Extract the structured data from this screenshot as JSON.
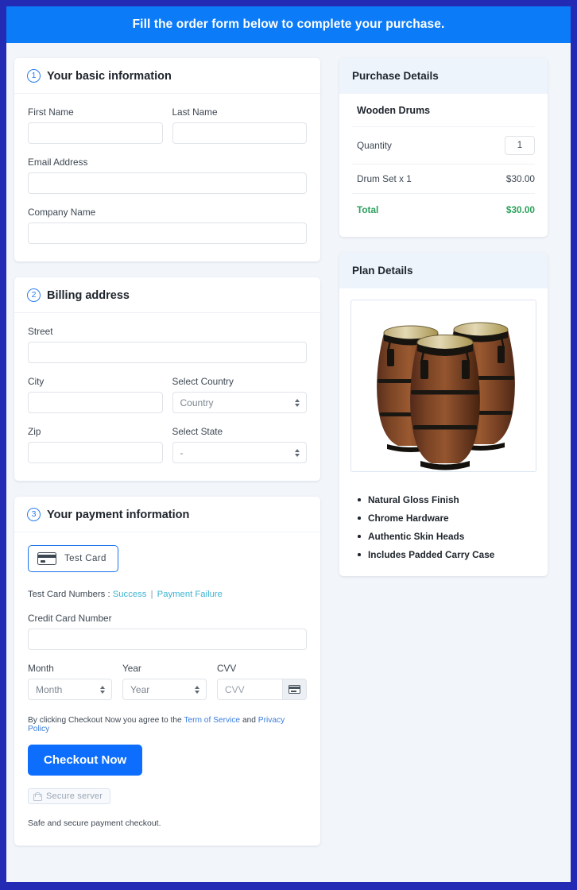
{
  "banner": {
    "text": "Fill the order form below to complete your purchase."
  },
  "colors": {
    "banner_blue": "#0b7bf8",
    "frame_navy": "#232ab4",
    "page_bg": "#f2f5f9",
    "accent_blue": "#0d6efd",
    "total_green": "#2ca05c",
    "link_teal": "#3fb3d2"
  },
  "sections": {
    "basic": {
      "step": "1",
      "title": "Your basic information",
      "fields": {
        "first_name_label": "First Name",
        "first_name_value": "",
        "last_name_label": "Last Name",
        "last_name_value": "",
        "email_label": "Email Address",
        "email_value": "",
        "company_label": "Company Name",
        "company_value": ""
      }
    },
    "billing": {
      "step": "2",
      "title": "Billing address",
      "fields": {
        "street_label": "Street",
        "street_value": "",
        "city_label": "City",
        "city_value": "",
        "country_label": "Select Country",
        "country_value": "Country",
        "zip_label": "Zip",
        "zip_value": "",
        "state_label": "Select State",
        "state_value": "-"
      }
    },
    "payment": {
      "step": "3",
      "title": "Your payment information",
      "card_tab_label": "Test  Card",
      "test_numbers_label": "Test Card Numbers :",
      "test_success_link": "Success",
      "test_separator": "|",
      "test_failure_link": "Payment Failure",
      "card_number_label": "Credit Card Number",
      "card_number_value": "",
      "month_label": "Month",
      "month_value": "Month",
      "year_label": "Year",
      "year_value": "Year",
      "cvv_label": "CVV",
      "cvv_placeholder": "CVV",
      "terms_prefix": "By clicking Checkout Now you agree to the",
      "terms_link": "Term of Service",
      "terms_and": "and",
      "privacy_link": "Privacy Policy",
      "checkout_button": "Checkout Now",
      "secure_badge": "Secure server",
      "safe_note": "Safe and secure payment checkout."
    }
  },
  "purchase_details": {
    "title": "Purchase Details",
    "product_name": "Wooden Drums",
    "quantity_label": "Quantity",
    "quantity_value": "1",
    "line_item_label": "Drum Set x 1",
    "line_item_amount": "$30.00",
    "total_label": "Total",
    "total_amount": "$30.00"
  },
  "plan_details": {
    "title": "Plan Details",
    "image_alt": "wooden-conga-drums-photo",
    "features": [
      "Natural Gloss Finish",
      "Chrome Hardware",
      "Authentic Skin Heads",
      "Includes Padded Carry Case"
    ]
  }
}
